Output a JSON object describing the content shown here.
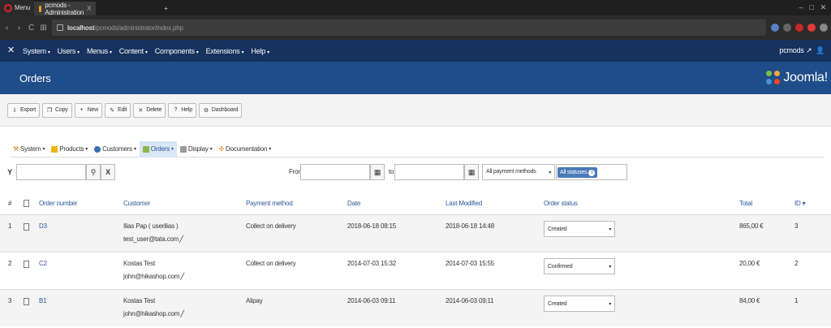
{
  "browser": {
    "menu_label": "Menu",
    "active_tab": "pcmods - Administration",
    "tab_close": "X",
    "url_host": "localhost",
    "url_path": "/pcmods/administrator/index.php",
    "nav_back": "‹",
    "nav_forward": "›",
    "nav_reload": "C",
    "nav_grid": "⊞"
  },
  "topnav": {
    "items": [
      "System",
      "Users",
      "Menus",
      "Content",
      "Components",
      "Extensions",
      "Help"
    ],
    "user": "pcmods"
  },
  "title": {
    "page": "Orders",
    "brand": "Joomla!"
  },
  "toolbar": {
    "buttons": [
      {
        "label": "Export",
        "icon": "⇩"
      },
      {
        "label": "Copy",
        "icon": "❐"
      },
      {
        "label": "New",
        "icon": "+"
      },
      {
        "label": "Edit",
        "icon": "✎"
      },
      {
        "label": "Delete",
        "icon": "✕"
      },
      {
        "label": "Help",
        "icon": "?"
      },
      {
        "label": "Dashboard",
        "icon": "⚙"
      }
    ]
  },
  "submenu": {
    "items": [
      "System",
      "Products",
      "Customers",
      "Orders",
      "Display",
      "Documentation"
    ]
  },
  "filters": {
    "filter_icon": "Y",
    "search_value": "",
    "search_icon": "⚲",
    "clear_icon": "X",
    "from_label": "From",
    "to_label": "to",
    "payment_select": "All payment methods",
    "status_chip": "All statuses",
    "status_count": "0"
  },
  "table": {
    "headers": {
      "hash": "#",
      "order_number": "Order number",
      "customer": "Customer",
      "payment": "Payment method",
      "date": "Date",
      "modified": "Last Modified",
      "status": "Order status",
      "total": "Total",
      "id": "ID ▾"
    },
    "rows": [
      {
        "index": "1",
        "number": "D3",
        "customer_name": "Ilias Pap ( userilias )",
        "customer_email": "test_user@tata.com",
        "payment": "Collect on delivery",
        "date": "2018-06-18 08:15",
        "modified": "2018-06-18 14:48",
        "status": "Created",
        "total": "865,00 €",
        "id": "3"
      },
      {
        "index": "2",
        "number": "C2",
        "customer_name": "Kostas Test",
        "customer_email": "john@hikashop.com",
        "payment": "Collect on delivery",
        "date": "2014-07-03 15:32",
        "modified": "2014-07-03 15:55",
        "status": "Confirmed",
        "total": "20,00 €",
        "id": "2"
      },
      {
        "index": "3",
        "number": "B1",
        "customer_name": "Kostas Test",
        "customer_email": "john@hikashop.com",
        "payment": "Alipay",
        "date": "2014-06-03 09:11",
        "modified": "2014-06-03 09:11",
        "status": "Created",
        "total": "84,00 €",
        "id": "1"
      }
    ]
  }
}
